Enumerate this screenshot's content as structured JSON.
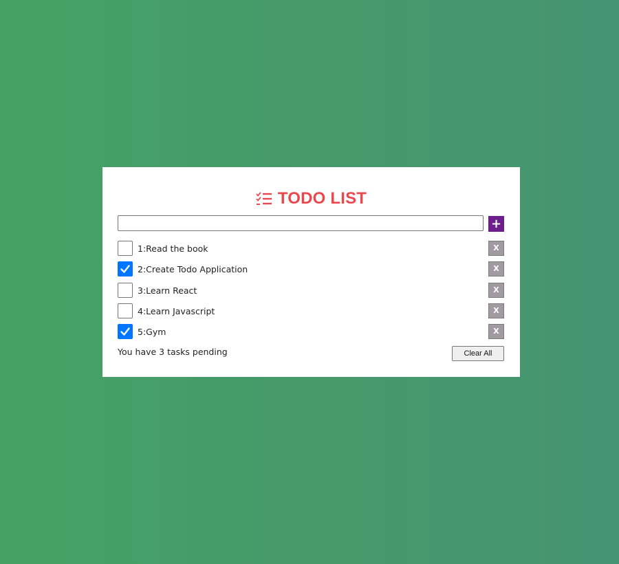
{
  "app": {
    "title": "TODO LIST",
    "title_icon": "checklist-icon",
    "accent_color": "#e8494e"
  },
  "add_form": {
    "input_value": "",
    "input_placeholder": "",
    "add_label": "+",
    "add_button_color": "#6c1f8a"
  },
  "tasks": [
    {
      "label": "1:Read the book",
      "checked": false,
      "delete_label": "X"
    },
    {
      "label": "2:Create Todo Application",
      "checked": true,
      "delete_label": "X"
    },
    {
      "label": "3:Learn React",
      "checked": false,
      "delete_label": "X"
    },
    {
      "label": "4:Learn Javascript",
      "checked": false,
      "delete_label": "X"
    },
    {
      "label": "5:Gym",
      "checked": true,
      "delete_label": "X"
    }
  ],
  "footer": {
    "pending_text": "You have 3 tasks pending",
    "clear_label": "Clear All"
  }
}
